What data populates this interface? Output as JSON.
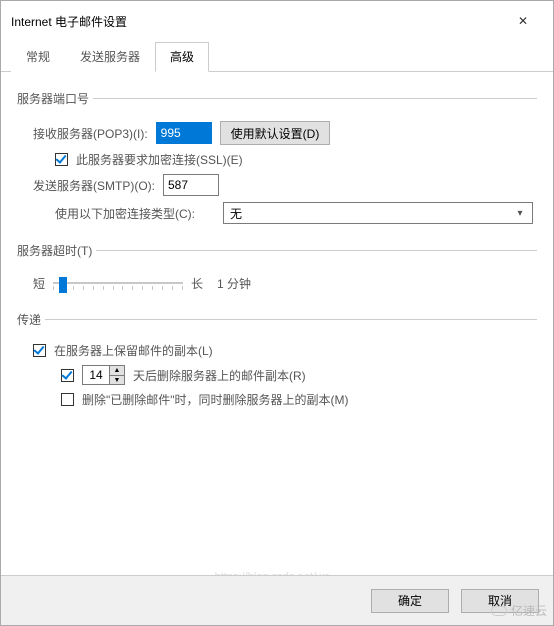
{
  "window": {
    "title": "Internet 电子邮件设置"
  },
  "tabs": {
    "general": "常规",
    "outgoing": "发送服务器",
    "advanced": "高级"
  },
  "group_ports": {
    "legend": "服务器端口号",
    "pop3_label": "接收服务器(POP3)(I):",
    "pop3_value": "995",
    "defaults_btn": "使用默认设置(D)",
    "ssl_label": "此服务器要求加密连接(SSL)(E)",
    "smtp_label": "发送服务器(SMTP)(O):",
    "smtp_value": "587",
    "enc_label": "使用以下加密连接类型(C):",
    "enc_value": "无"
  },
  "group_timeout": {
    "legend": "服务器超时(T)",
    "short": "短",
    "long": "长",
    "value": "1 分钟"
  },
  "group_delivery": {
    "legend": "传递",
    "keep_label": "在服务器上保留邮件的副本(L)",
    "remove_days_value": "14",
    "remove_days_label": "天后删除服务器上的邮件副本(R)",
    "remove_deleted_label": "删除\"已删除邮件\"时，同时删除服务器上的副本(M)"
  },
  "footer": {
    "ok": "确定",
    "cancel": "取消"
  },
  "watermark": {
    "text1": "https://blog.csdn.net/wa...",
    "text2": "亿速云"
  }
}
